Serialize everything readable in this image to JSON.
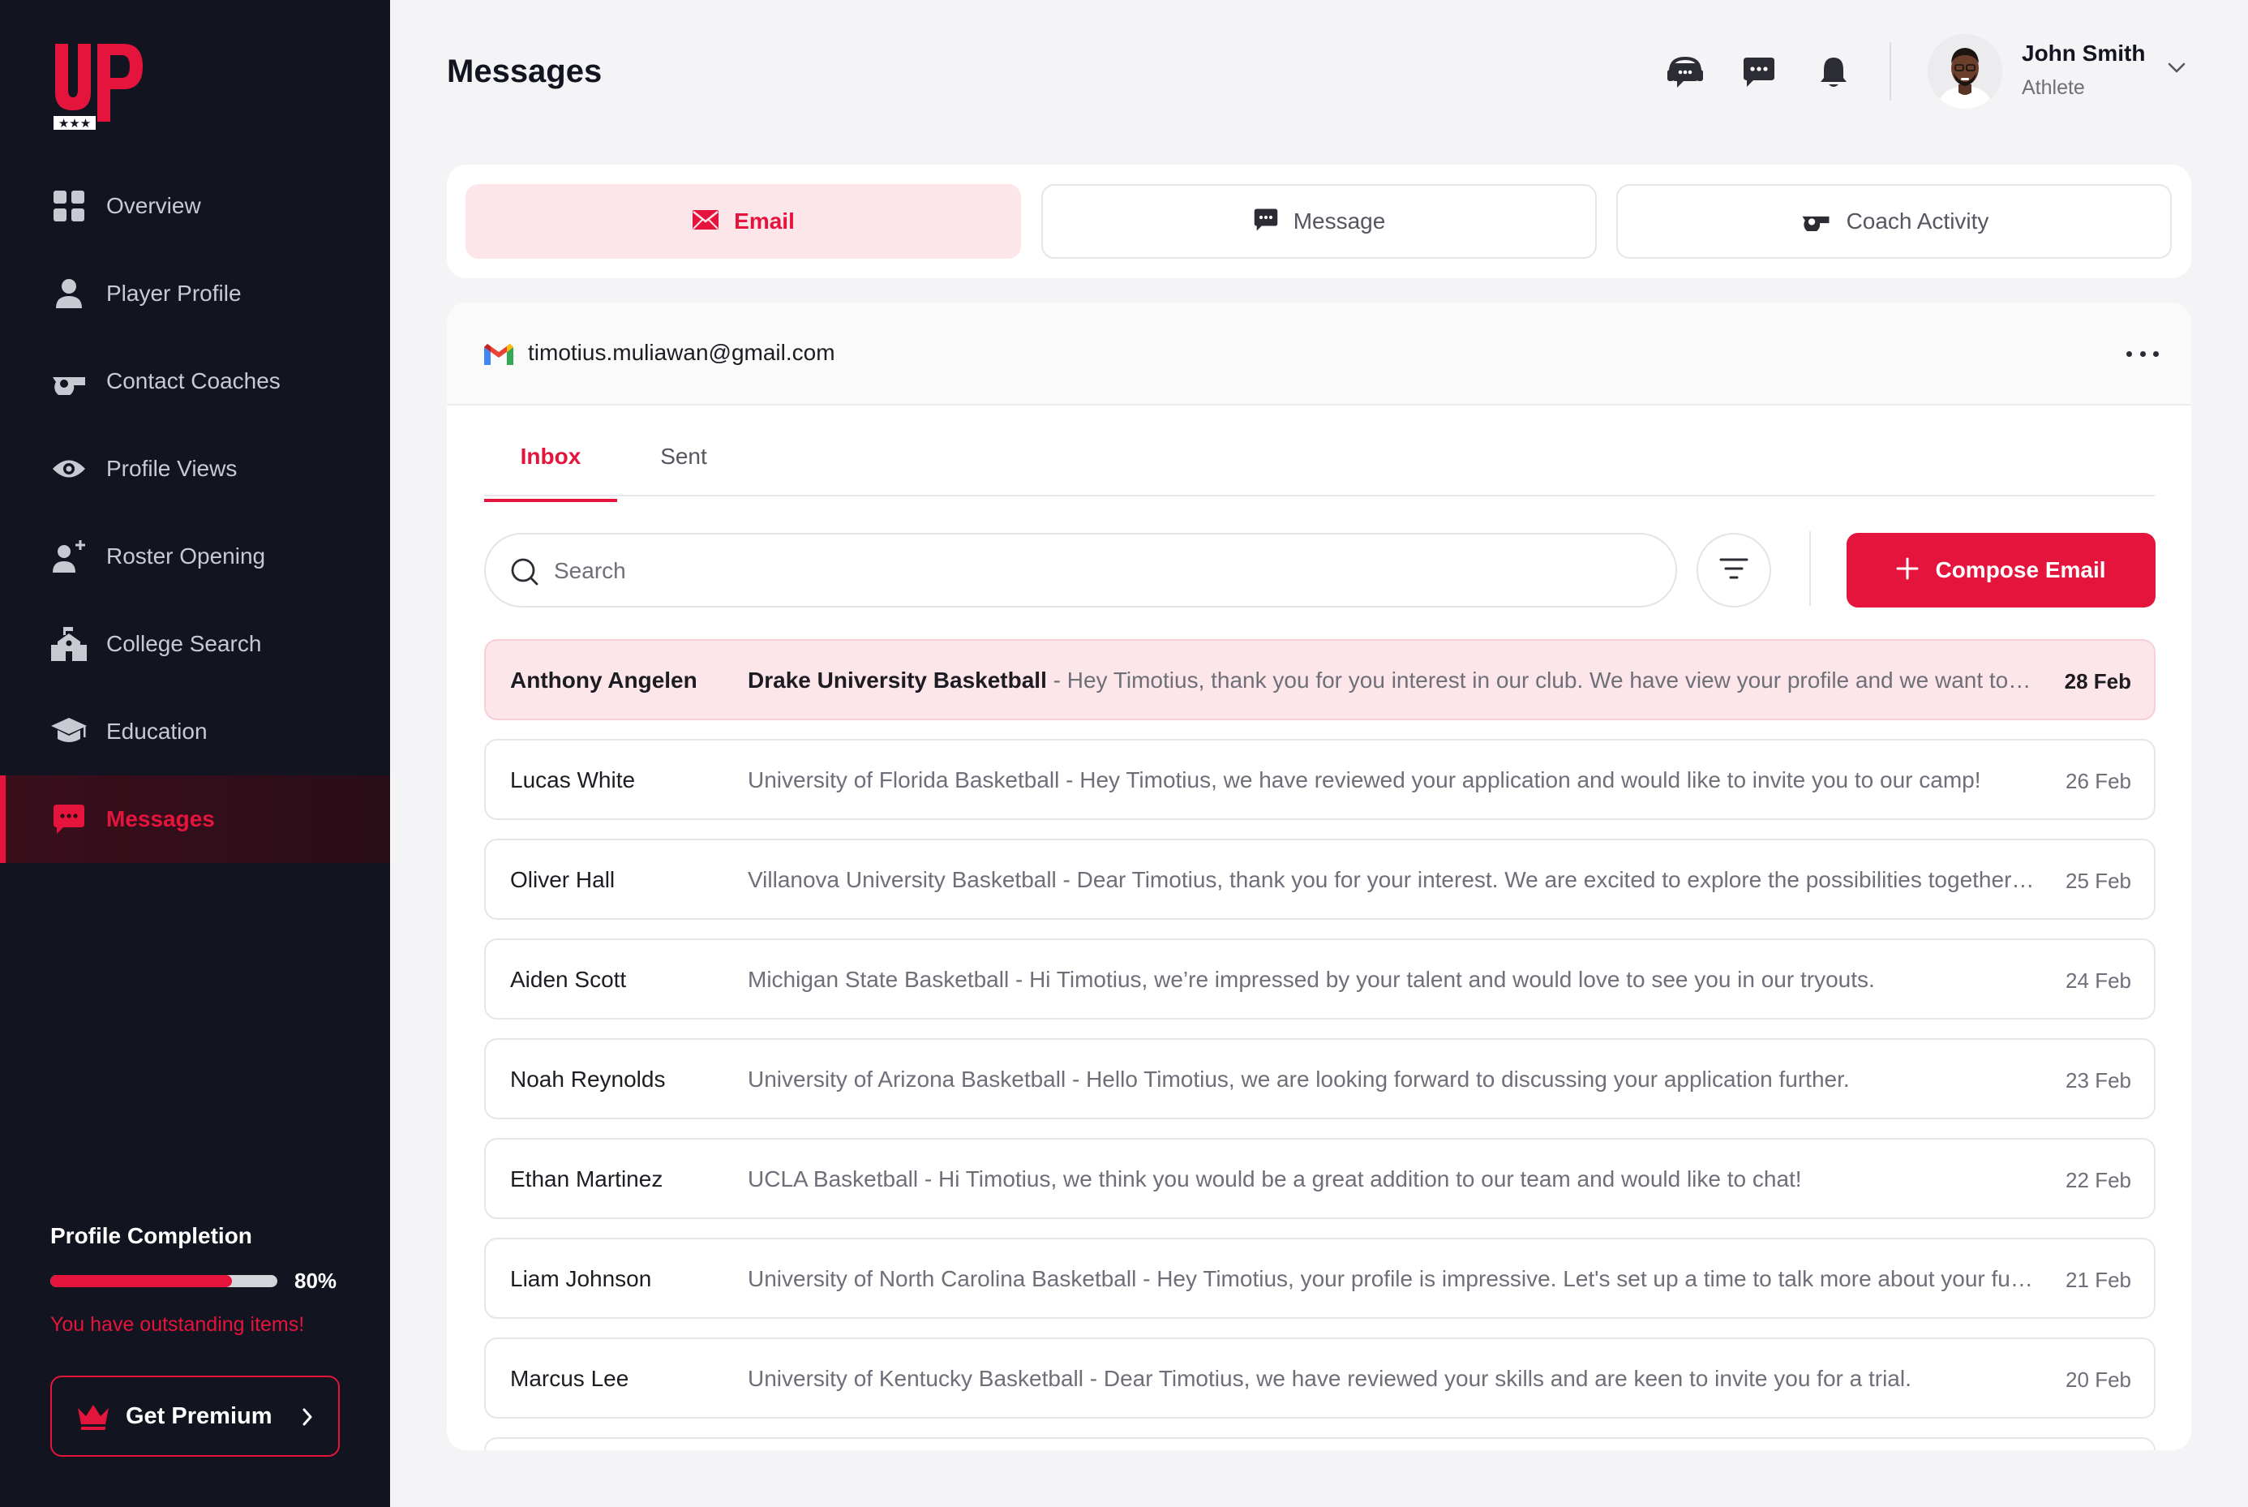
{
  "brand": {
    "logo_text": "UP",
    "accent": "#e4143c",
    "sidebar_bg": "#121420"
  },
  "sidebar": {
    "items": [
      {
        "label": "Overview",
        "icon": "grid-icon"
      },
      {
        "label": "Player Profile",
        "icon": "user-icon"
      },
      {
        "label": "Contact Coaches",
        "icon": "whistle-icon"
      },
      {
        "label": "Profile Views",
        "icon": "eye-icon"
      },
      {
        "label": "Roster Opening",
        "icon": "add-user-icon"
      },
      {
        "label": "College Search",
        "icon": "building-icon"
      },
      {
        "label": "Education",
        "icon": "graduation-cap-icon"
      },
      {
        "label": "Messages",
        "icon": "chat-icon",
        "active": true
      }
    ],
    "profile_completion": {
      "title": "Profile Completion",
      "percent": 80,
      "percent_label": "80%",
      "warning": "You have outstanding items!"
    },
    "premium_label": "Get Premium"
  },
  "header": {
    "title": "Messages",
    "user": {
      "name": "John Smith",
      "role": "Athlete"
    }
  },
  "message_types": [
    {
      "label": "Email",
      "icon": "envelope-icon",
      "active": true
    },
    {
      "label": "Message",
      "icon": "chat-icon",
      "active": false
    },
    {
      "label": "Coach Activity",
      "icon": "whistle-icon",
      "active": false
    }
  ],
  "mailbox": {
    "address": "timotius.muliawan@gmail.com",
    "tabs": [
      "Inbox",
      "Sent"
    ],
    "active_tab": "Inbox",
    "search_placeholder": "Search",
    "compose_label": "Compose Email"
  },
  "emails": [
    {
      "sender": "Anthony Angelen",
      "subject": "Drake University Basketball",
      "preview": "Hey Timotius, thank you for you interest in our club. We have view your profile and we want to discuss further with you.",
      "date": "28 Feb",
      "unread": true
    },
    {
      "sender": "Lucas White",
      "subject": "University of Florida Basketball",
      "preview": "Hey Timotius, we have reviewed your application and would like to invite you to our camp!",
      "date": "26 Feb",
      "unread": false
    },
    {
      "sender": "Oliver Hall",
      "subject": "Villanova University Basketball",
      "preview": "Dear Timotius, thank you for your interest. We are excited to explore the possibilities together with you.",
      "date": "25 Feb",
      "unread": false
    },
    {
      "sender": "Aiden Scott",
      "subject": "Michigan State Basketball",
      "preview": "Hi Timotius, we’re impressed by your talent and would love to see you in our tryouts.",
      "date": "24 Feb",
      "unread": false
    },
    {
      "sender": "Noah Reynolds",
      "subject": "University of Arizona Basketball",
      "preview": "Hello Timotius, we are looking forward to discussing your application further.",
      "date": "23 Feb",
      "unread": false
    },
    {
      "sender": "Ethan Martinez",
      "subject": "UCLA Basketball",
      "preview": "Hi Timotius, we think you would be a great addition to our team and would like to chat!",
      "date": "22 Feb",
      "unread": false
    },
    {
      "sender": "Liam Johnson",
      "subject": "University of North Carolina Basketball",
      "preview": "Hey Timotius, your profile is impressive. Let's set up a time to talk more about your future with us.",
      "date": "21 Feb",
      "unread": false
    },
    {
      "sender": "Marcus Lee",
      "subject": "University of Kentucky Basketball",
      "preview": "Dear Timotius, we have reviewed your skills and are keen to invite you for a trial.",
      "date": "20 Feb",
      "unread": false
    }
  ]
}
